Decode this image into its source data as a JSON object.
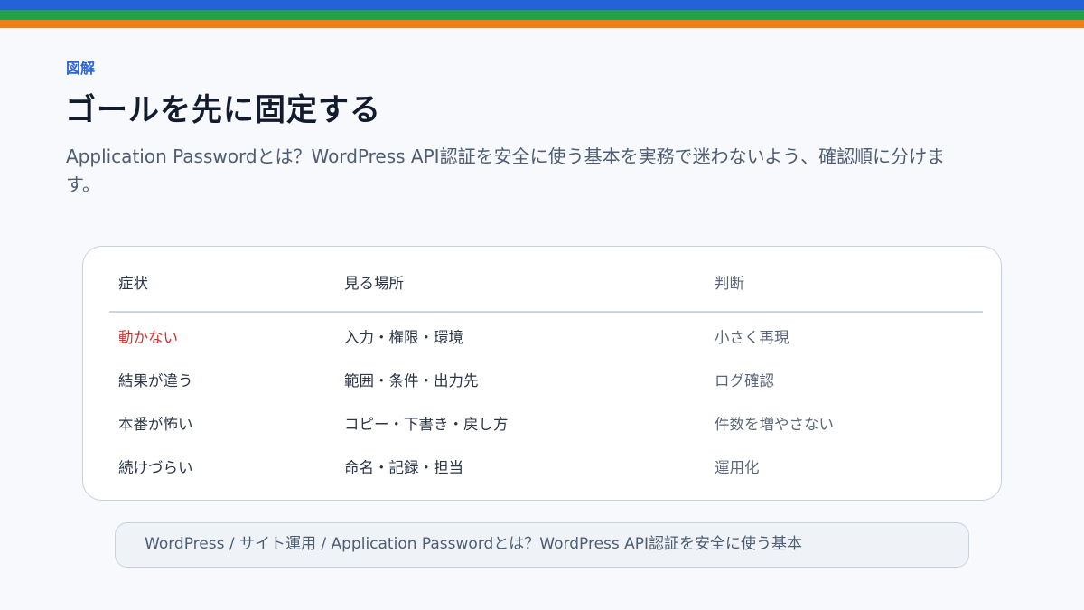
{
  "header": {
    "stripe_colors": [
      "#2462d8",
      "#26a047",
      "#f07d18"
    ],
    "eyebrow": "図解",
    "title": "ゴールを先に固定する",
    "lead": "Application Passwordとは？WordPress API認証を安全に使う基本を実務で迷わないよう、確認順に分けます。"
  },
  "table": {
    "columns": [
      "症状",
      "見る場所",
      "判断"
    ],
    "rows": [
      [
        "動かない",
        "入力・権限・環境",
        "小さく再現"
      ],
      [
        "結果が違う",
        "範囲・条件・出力先",
        "ログ確認"
      ],
      [
        "本番が怖い",
        "コピー・下書き・戻し方",
        "件数を増やさない"
      ],
      [
        "続けづらい",
        "命名・記録・担当",
        "運用化"
      ]
    ],
    "alert_color": "#d0312d"
  },
  "breadcrumb": {
    "text": "WordPress / サイト運用 / Application Passwordとは？WordPress API認証を安全に使う基本"
  }
}
